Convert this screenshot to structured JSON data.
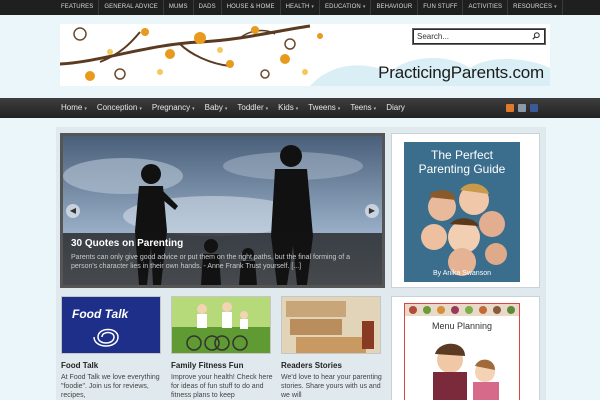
{
  "topnav": {
    "items": [
      {
        "label": "Features",
        "dropdown": false
      },
      {
        "label": "General Advice",
        "dropdown": false
      },
      {
        "label": "Mums",
        "dropdown": false
      },
      {
        "label": "Dads",
        "dropdown": false
      },
      {
        "label": "House & Home",
        "dropdown": false
      },
      {
        "label": "Health",
        "dropdown": true
      },
      {
        "label": "Education",
        "dropdown": true
      },
      {
        "label": "Behaviour",
        "dropdown": false
      },
      {
        "label": "Fun Stuff",
        "dropdown": false
      },
      {
        "label": "Activities",
        "dropdown": false
      },
      {
        "label": "Resources",
        "dropdown": true
      }
    ]
  },
  "header": {
    "logo": "PracticingParents.com",
    "search_placeholder": "Search..."
  },
  "mainnav": {
    "items": [
      {
        "label": "Home",
        "dropdown": true
      },
      {
        "label": "Conception",
        "dropdown": true
      },
      {
        "label": "Pregnancy",
        "dropdown": true
      },
      {
        "label": "Baby",
        "dropdown": true
      },
      {
        "label": "Toddler",
        "dropdown": true
      },
      {
        "label": "Kids",
        "dropdown": true
      },
      {
        "label": "Tweens",
        "dropdown": true
      },
      {
        "label": "Teens",
        "dropdown": true
      },
      {
        "label": "Diary",
        "dropdown": false
      }
    ],
    "social_icons": [
      "rss-icon",
      "email-icon",
      "facebook-icon"
    ]
  },
  "slider": {
    "title": "30 Quotes on Parenting",
    "text": "Parents can only give good advice or put them on the right paths, but the final forming of a person's character lies in their own hands. - Anne Frank Trust yourself. [...]"
  },
  "book": {
    "title_line1": "The Perfect",
    "title_line2": "Parenting Guide",
    "author": "By Anika Swanson"
  },
  "cards": [
    {
      "title": "Food Talk",
      "text": "At Food Talk we love everything \"foodie\". Join us for reviews, recipes,",
      "thumb_label": "Food Talk"
    },
    {
      "title": "Family Fitness Fun",
      "text": "Improve your health! Check here for ideas of fun stuff to do and fitness plans to keep"
    },
    {
      "title": "Readers Stories",
      "text": "We'd love to hear your parenting stories. Share yours with us and we will"
    }
  ],
  "menu_card": {
    "title": "Menu Planning"
  }
}
